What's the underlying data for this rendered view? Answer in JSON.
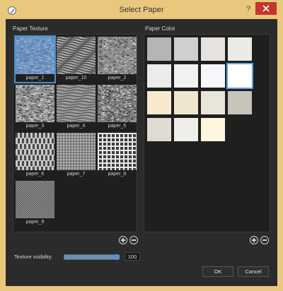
{
  "window": {
    "title": "Select Paper",
    "help_label": "?",
    "icon": "app-logo-icon",
    "close_icon": "close-icon"
  },
  "paper_texture": {
    "label": "Paper Texture",
    "items": [
      {
        "name": "paper_1",
        "selected": true
      },
      {
        "name": "paper_10",
        "selected": false
      },
      {
        "name": "paper_2",
        "selected": false
      },
      {
        "name": "paper_3",
        "selected": false
      },
      {
        "name": "paper_4",
        "selected": false
      },
      {
        "name": "paper_5",
        "selected": false
      },
      {
        "name": "paper_6",
        "selected": false
      },
      {
        "name": "paper_7",
        "selected": false
      },
      {
        "name": "paper_8",
        "selected": false
      },
      {
        "name": "paper_9",
        "selected": false
      }
    ],
    "add_icon": "plus-circle-icon",
    "remove_icon": "minus-circle-icon"
  },
  "paper_color": {
    "label": "Paper Color",
    "swatches": [
      {
        "color": "#b5b5b5",
        "selected": false
      },
      {
        "color": "#cfcfcf",
        "selected": false
      },
      {
        "color": "#e6e2df",
        "selected": false
      },
      {
        "color": "#ebeae5",
        "selected": false
      },
      {
        "color": "#ecebea",
        "selected": false
      },
      {
        "color": "#f1f1f1",
        "selected": false
      },
      {
        "color": "#f6f6fb",
        "selected": false
      },
      {
        "color": "#ffffff",
        "selected": true
      },
      {
        "color": "#f8e9ce",
        "selected": false
      },
      {
        "color": "#efe6cf",
        "selected": false
      },
      {
        "color": "#e9e5da",
        "selected": false
      },
      {
        "color": "#c7c5ba",
        "selected": false
      },
      {
        "color": "#dedbd3",
        "selected": false
      },
      {
        "color": "#f0eee8",
        "selected": false
      },
      {
        "color": "#fdf5dc",
        "selected": false
      }
    ],
    "add_icon": "plus-circle-icon",
    "remove_icon": "minus-circle-icon"
  },
  "texture_visibility": {
    "label": "Texture visibility:",
    "value": "100",
    "level": 1.0,
    "accent": "#4a90e2"
  },
  "buttons": {
    "ok": "OK",
    "cancel": "Cancel"
  }
}
